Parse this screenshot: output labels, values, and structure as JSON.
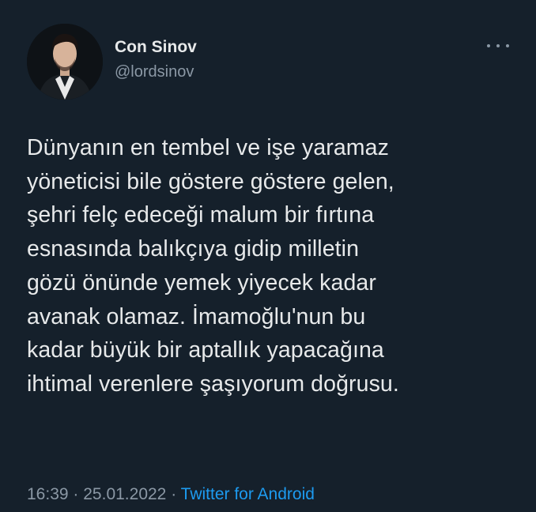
{
  "author": {
    "display_name": "Con Sinov",
    "handle": "@lordsinov",
    "avatar_icon": "profile-photo"
  },
  "more_icon": "ellipsis-icon",
  "tweet": {
    "lines": [
      "Dünyanın en tembel ve işe yaramaz",
      "yöneticisi bile göstere göstere gelen,",
      "şehri felç edeceği malum bir fırtına",
      "esnasında balıkçıya gidip milletin",
      "gözü önünde yemek yiyecek kadar",
      "avanak olamaz. İmamoğlu'nun bu",
      "kadar büyük bir aptallık yapacağına",
      "ihtimal verenlere şaşıyorum doğrusu."
    ]
  },
  "meta": {
    "time": "16:39",
    "separator": "·",
    "date": "25.01.2022",
    "source": "Twitter for Android"
  },
  "colors": {
    "background": "#15202b",
    "text": "#e7e9ea",
    "secondary": "#8b98a5",
    "link": "#1d9bf0"
  }
}
